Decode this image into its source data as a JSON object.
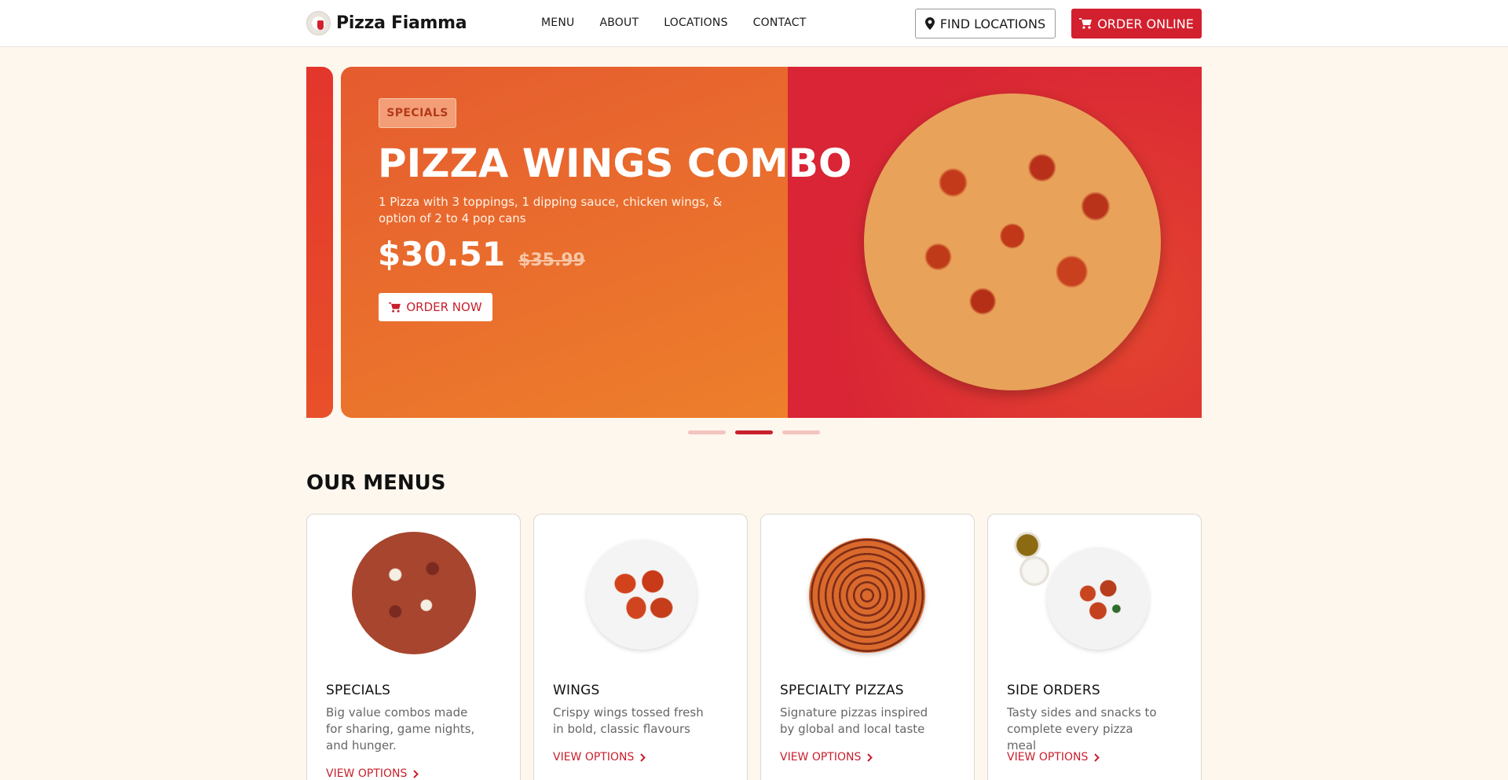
{
  "header": {
    "brand": "Pizza Fiamma",
    "nav": [
      "MENU",
      "ABOUT",
      "LOCATIONS",
      "CONTACT"
    ],
    "find_locations_label": "FIND LOCATIONS",
    "order_online_label": "ORDER ONLINE"
  },
  "hero": {
    "badge": "SPECIALS",
    "title": "PIZZA WINGS COMBO",
    "description": "1 Pizza with 3 toppings, 1 dipping sauce, chicken wings, & option of 2 to 4 pop cans",
    "price": "$30.51",
    "old_price": "$35.99",
    "order_now_label": "ORDER NOW",
    "active_slide": 2,
    "slide_count": 3
  },
  "menus": {
    "title": "OUR MENUS",
    "cards": [
      {
        "title": "SPECIALS",
        "description": "Big value combos made for sharing, game nights, and hunger.",
        "link": "VIEW OPTIONS"
      },
      {
        "title": "WINGS",
        "description": "Crispy wings tossed fresh in bold, classic flavours",
        "link": "VIEW OPTIONS"
      },
      {
        "title": "SPECIALTY PIZZAS",
        "description": "Signature pizzas inspired by global and local taste",
        "link": "VIEW OPTIONS"
      },
      {
        "title": "SIDE ORDERS",
        "description": "Tasty sides and snacks to complete every pizza meal",
        "link": "VIEW OPTIONS"
      }
    ]
  },
  "colors": {
    "brand_red": "#d3202f",
    "background": "#fdf7ee",
    "hero_orange": "#f08a2a"
  },
  "icons": {
    "location": "map-pin-icon",
    "cart": "cart-icon",
    "chevron": "chevron-right-icon"
  }
}
